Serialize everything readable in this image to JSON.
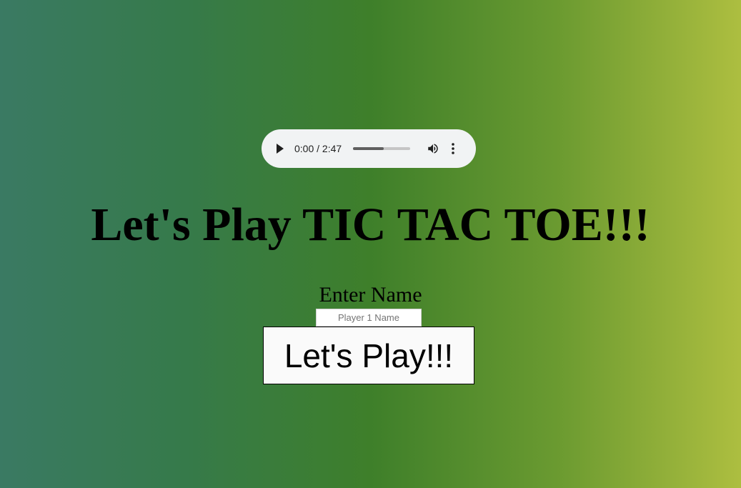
{
  "audio_player": {
    "current_time": "0:00",
    "duration": "2:47",
    "time_text": "0:00 / 2:47",
    "buffered_fraction": 0.53
  },
  "page": {
    "title": "Let's Play TIC TAC TOE!!!"
  },
  "form": {
    "name_label": "Enter Name",
    "name_value": "",
    "name_placeholder": "Player 1 Name",
    "submit_label": "Let's Play!!!"
  },
  "colors": {
    "background_gradient": [
      "#3a7a63",
      "#367a4a",
      "#3e7f2a",
      "#6a9a30",
      "#adbe40"
    ],
    "player_bg": "#f1f3f4",
    "button_bg": "#fafafa"
  }
}
